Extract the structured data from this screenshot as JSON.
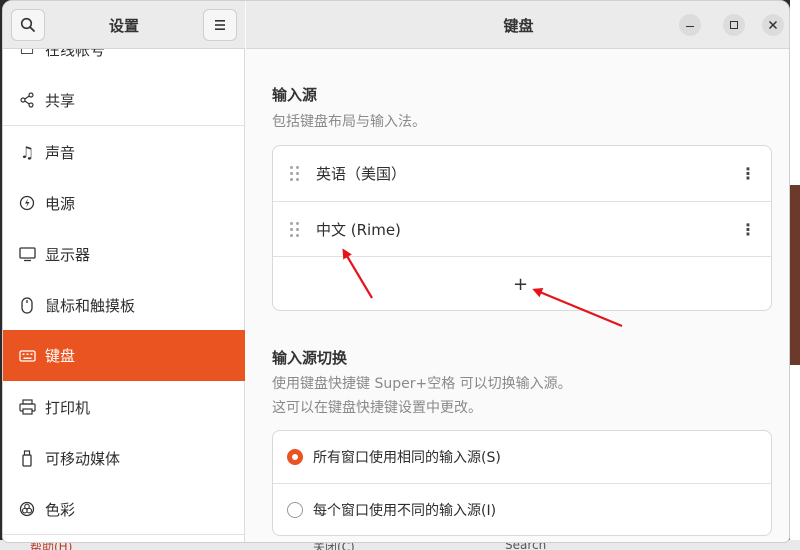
{
  "sidebar": {
    "title": "设置",
    "search_icon": "search-icon",
    "menu_icon": "menu-icon",
    "items": [
      {
        "label": "在线帐号",
        "icon": "online-accounts-icon"
      },
      {
        "label": "共享",
        "icon": "share-icon"
      },
      {
        "label": "声音",
        "icon": "music-note-icon"
      },
      {
        "label": "电源",
        "icon": "power-icon"
      },
      {
        "label": "显示器",
        "icon": "display-icon"
      },
      {
        "label": "鼠标和触摸板",
        "icon": "mouse-icon"
      },
      {
        "label": "键盘",
        "icon": "keyboard-icon",
        "active": true
      },
      {
        "label": "打印机",
        "icon": "printer-icon"
      },
      {
        "label": "可移动媒体",
        "icon": "removable-media-icon"
      },
      {
        "label": "色彩",
        "icon": "color-icon"
      }
    ]
  },
  "header": {
    "title": "键盘"
  },
  "input_sources": {
    "title": "输入源",
    "description": "包括键盘布局与输入法。",
    "items": [
      {
        "label": "英语（美国）"
      },
      {
        "label": "中文 (Rime)"
      }
    ],
    "add_label": "+"
  },
  "switching": {
    "title": "输入源切换",
    "description_line1": "使用键盘快捷键 Super+空格 可以切换输入源。",
    "description_line2": "这可以在键盘快捷键设置中更改。",
    "options": [
      {
        "label": "所有窗口使用相同的输入源(S)",
        "selected": true
      },
      {
        "label": "每个窗口使用不同的输入源(I)",
        "selected": false
      }
    ]
  },
  "background": {
    "help_text": "帮助(H)",
    "close_text": "关闭(C)",
    "search_text": "Search"
  },
  "colors": {
    "accent": "#e95420",
    "annotation_arrow": "#e5141c"
  }
}
